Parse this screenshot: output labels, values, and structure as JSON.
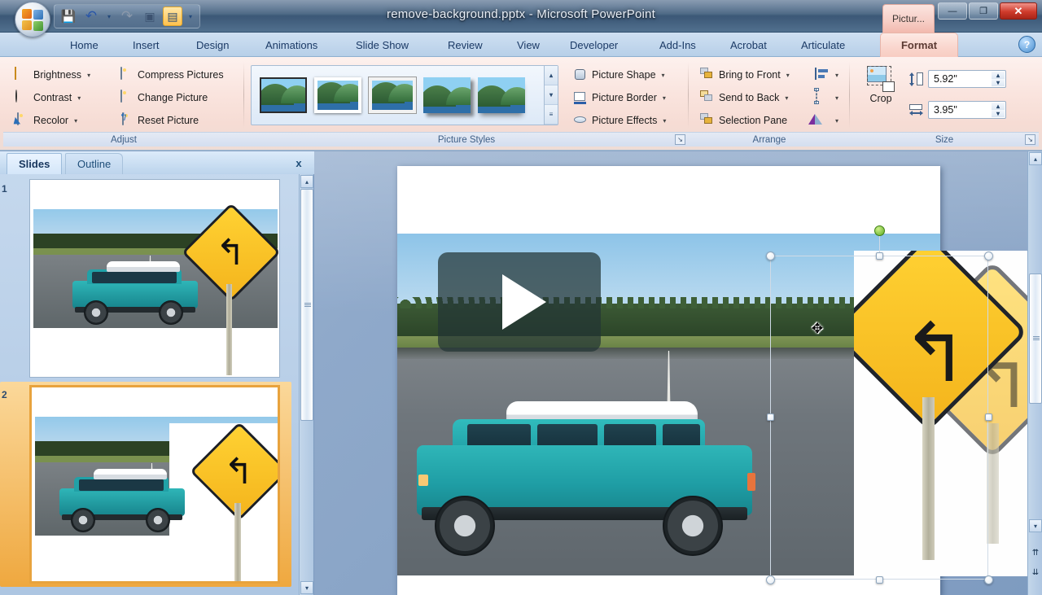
{
  "window": {
    "title": "remove-background.pptx - Microsoft PowerPoint",
    "contextual_tab": "Pictur...",
    "minimize": "—",
    "maximize": "❐",
    "close": "✕"
  },
  "quick_access": {
    "items": [
      {
        "name": "save-icon",
        "glyph": "💾"
      },
      {
        "name": "undo-icon",
        "glyph": "↶"
      },
      {
        "name": "redo-icon",
        "glyph": "↷"
      },
      {
        "name": "slideshow-icon",
        "glyph": "▣"
      },
      {
        "name": "presentation-icon",
        "glyph": "▤"
      }
    ],
    "customize_caret": "▾",
    "undo_caret": "▾"
  },
  "ribbon": {
    "tabs": [
      {
        "label": "Home",
        "selected": false
      },
      {
        "label": "Insert",
        "selected": false
      },
      {
        "label": "Design",
        "selected": false
      },
      {
        "label": "Animations",
        "selected": false
      },
      {
        "label": "Slide Show",
        "selected": false
      },
      {
        "label": "Review",
        "selected": false
      },
      {
        "label": "View",
        "selected": false
      },
      {
        "label": "Developer",
        "selected": false
      },
      {
        "label": "Add-Ins",
        "selected": false
      },
      {
        "label": "Acrobat",
        "selected": false
      },
      {
        "label": "Articulate",
        "selected": false
      },
      {
        "label": "Format",
        "selected": true
      }
    ],
    "help_glyph": "?",
    "groups": {
      "adjust": {
        "name": "Adjust",
        "items": [
          {
            "label": "Brightness",
            "has_caret": true
          },
          {
            "label": "Contrast",
            "has_caret": true
          },
          {
            "label": "Recolor",
            "has_caret": true
          },
          {
            "label": "Compress Pictures",
            "has_caret": false
          },
          {
            "label": "Change Picture",
            "has_caret": false
          },
          {
            "label": "Reset Picture",
            "has_caret": false
          }
        ]
      },
      "picture_styles": {
        "name": "Picture Styles",
        "gallery_count": 5,
        "scroll_up": "▴",
        "scroll_down": "▾",
        "scroll_more": "≡",
        "dialog_launcher": "↘",
        "items": [
          {
            "label": "Picture Shape",
            "has_caret": true
          },
          {
            "label": "Picture Border",
            "has_caret": true
          },
          {
            "label": "Picture Effects",
            "has_caret": true
          }
        ]
      },
      "arrange": {
        "name": "Arrange",
        "items": [
          {
            "label": "Bring to Front",
            "has_caret": true
          },
          {
            "label": "Send to Back",
            "has_caret": true
          },
          {
            "label": "Selection Pane",
            "has_caret": false
          }
        ],
        "icon_buttons": [
          {
            "name": "align-icon",
            "caret": "▾"
          },
          {
            "name": "group-icon",
            "caret": "▾"
          },
          {
            "name": "rotate-icon",
            "caret": "▾"
          }
        ]
      },
      "size": {
        "name": "Size",
        "crop_label": "Crop",
        "height_value": "5.92\"",
        "width_value": "3.95\"",
        "spin_up": "▴",
        "spin_down": "▾",
        "dialog_launcher": "↘"
      }
    }
  },
  "left_pane": {
    "tabs": [
      {
        "label": "Slides",
        "selected": true
      },
      {
        "label": "Outline",
        "selected": false
      }
    ],
    "close_label": "x",
    "slides": [
      {
        "number": "1",
        "selected": false
      },
      {
        "number": "2",
        "selected": true
      }
    ],
    "scroll": {
      "up": "▴",
      "down": "▾"
    }
  },
  "main": {
    "video_overlay": {
      "play_glyph": "▶"
    },
    "selection": {
      "move_cursor_glyph": "✥",
      "rotate_handle_name": "rotation-handle",
      "handle_count": 8
    }
  },
  "vscroll": {
    "up": "▴",
    "down": "▾",
    "prev_slide": "⇈",
    "next_slide": "⇊"
  }
}
